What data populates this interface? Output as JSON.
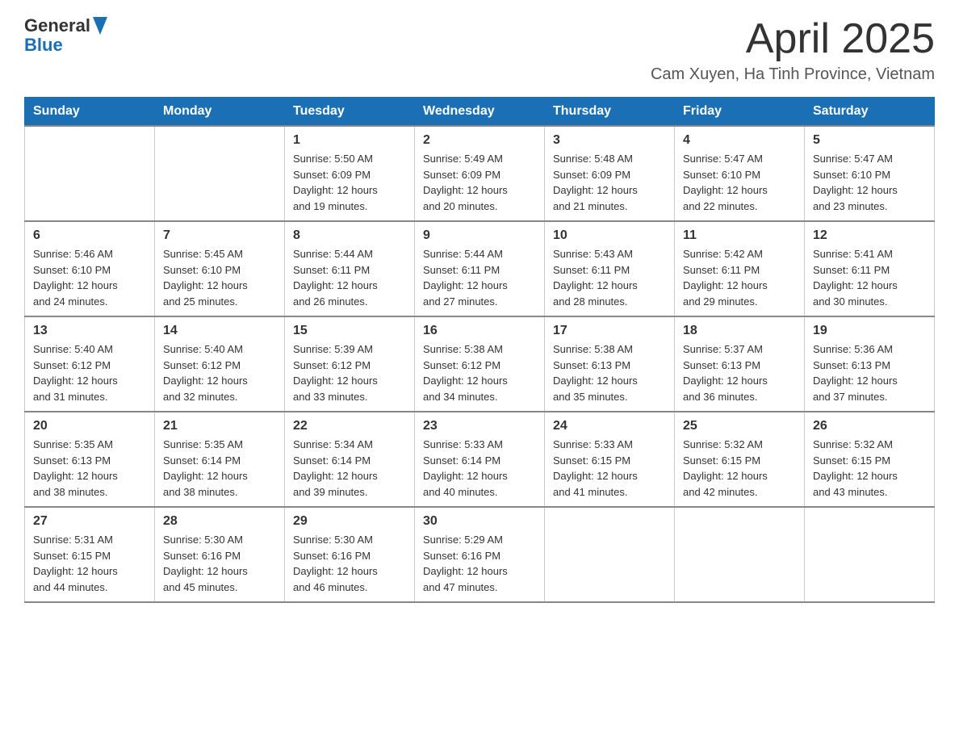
{
  "header": {
    "logo": {
      "general": "General",
      "blue": "Blue"
    },
    "title": "April 2025",
    "location": "Cam Xuyen, Ha Tinh Province, Vietnam"
  },
  "calendar": {
    "weekdays": [
      "Sunday",
      "Monday",
      "Tuesday",
      "Wednesday",
      "Thursday",
      "Friday",
      "Saturday"
    ],
    "weeks": [
      [
        {
          "day": "",
          "info": ""
        },
        {
          "day": "",
          "info": ""
        },
        {
          "day": "1",
          "info": "Sunrise: 5:50 AM\nSunset: 6:09 PM\nDaylight: 12 hours\nand 19 minutes."
        },
        {
          "day": "2",
          "info": "Sunrise: 5:49 AM\nSunset: 6:09 PM\nDaylight: 12 hours\nand 20 minutes."
        },
        {
          "day": "3",
          "info": "Sunrise: 5:48 AM\nSunset: 6:09 PM\nDaylight: 12 hours\nand 21 minutes."
        },
        {
          "day": "4",
          "info": "Sunrise: 5:47 AM\nSunset: 6:10 PM\nDaylight: 12 hours\nand 22 minutes."
        },
        {
          "day": "5",
          "info": "Sunrise: 5:47 AM\nSunset: 6:10 PM\nDaylight: 12 hours\nand 23 minutes."
        }
      ],
      [
        {
          "day": "6",
          "info": "Sunrise: 5:46 AM\nSunset: 6:10 PM\nDaylight: 12 hours\nand 24 minutes."
        },
        {
          "day": "7",
          "info": "Sunrise: 5:45 AM\nSunset: 6:10 PM\nDaylight: 12 hours\nand 25 minutes."
        },
        {
          "day": "8",
          "info": "Sunrise: 5:44 AM\nSunset: 6:11 PM\nDaylight: 12 hours\nand 26 minutes."
        },
        {
          "day": "9",
          "info": "Sunrise: 5:44 AM\nSunset: 6:11 PM\nDaylight: 12 hours\nand 27 minutes."
        },
        {
          "day": "10",
          "info": "Sunrise: 5:43 AM\nSunset: 6:11 PM\nDaylight: 12 hours\nand 28 minutes."
        },
        {
          "day": "11",
          "info": "Sunrise: 5:42 AM\nSunset: 6:11 PM\nDaylight: 12 hours\nand 29 minutes."
        },
        {
          "day": "12",
          "info": "Sunrise: 5:41 AM\nSunset: 6:11 PM\nDaylight: 12 hours\nand 30 minutes."
        }
      ],
      [
        {
          "day": "13",
          "info": "Sunrise: 5:40 AM\nSunset: 6:12 PM\nDaylight: 12 hours\nand 31 minutes."
        },
        {
          "day": "14",
          "info": "Sunrise: 5:40 AM\nSunset: 6:12 PM\nDaylight: 12 hours\nand 32 minutes."
        },
        {
          "day": "15",
          "info": "Sunrise: 5:39 AM\nSunset: 6:12 PM\nDaylight: 12 hours\nand 33 minutes."
        },
        {
          "day": "16",
          "info": "Sunrise: 5:38 AM\nSunset: 6:12 PM\nDaylight: 12 hours\nand 34 minutes."
        },
        {
          "day": "17",
          "info": "Sunrise: 5:38 AM\nSunset: 6:13 PM\nDaylight: 12 hours\nand 35 minutes."
        },
        {
          "day": "18",
          "info": "Sunrise: 5:37 AM\nSunset: 6:13 PM\nDaylight: 12 hours\nand 36 minutes."
        },
        {
          "day": "19",
          "info": "Sunrise: 5:36 AM\nSunset: 6:13 PM\nDaylight: 12 hours\nand 37 minutes."
        }
      ],
      [
        {
          "day": "20",
          "info": "Sunrise: 5:35 AM\nSunset: 6:13 PM\nDaylight: 12 hours\nand 38 minutes."
        },
        {
          "day": "21",
          "info": "Sunrise: 5:35 AM\nSunset: 6:14 PM\nDaylight: 12 hours\nand 38 minutes."
        },
        {
          "day": "22",
          "info": "Sunrise: 5:34 AM\nSunset: 6:14 PM\nDaylight: 12 hours\nand 39 minutes."
        },
        {
          "day": "23",
          "info": "Sunrise: 5:33 AM\nSunset: 6:14 PM\nDaylight: 12 hours\nand 40 minutes."
        },
        {
          "day": "24",
          "info": "Sunrise: 5:33 AM\nSunset: 6:15 PM\nDaylight: 12 hours\nand 41 minutes."
        },
        {
          "day": "25",
          "info": "Sunrise: 5:32 AM\nSunset: 6:15 PM\nDaylight: 12 hours\nand 42 minutes."
        },
        {
          "day": "26",
          "info": "Sunrise: 5:32 AM\nSunset: 6:15 PM\nDaylight: 12 hours\nand 43 minutes."
        }
      ],
      [
        {
          "day": "27",
          "info": "Sunrise: 5:31 AM\nSunset: 6:15 PM\nDaylight: 12 hours\nand 44 minutes."
        },
        {
          "day": "28",
          "info": "Sunrise: 5:30 AM\nSunset: 6:16 PM\nDaylight: 12 hours\nand 45 minutes."
        },
        {
          "day": "29",
          "info": "Sunrise: 5:30 AM\nSunset: 6:16 PM\nDaylight: 12 hours\nand 46 minutes."
        },
        {
          "day": "30",
          "info": "Sunrise: 5:29 AM\nSunset: 6:16 PM\nDaylight: 12 hours\nand 47 minutes."
        },
        {
          "day": "",
          "info": ""
        },
        {
          "day": "",
          "info": ""
        },
        {
          "day": "",
          "info": ""
        }
      ]
    ]
  }
}
